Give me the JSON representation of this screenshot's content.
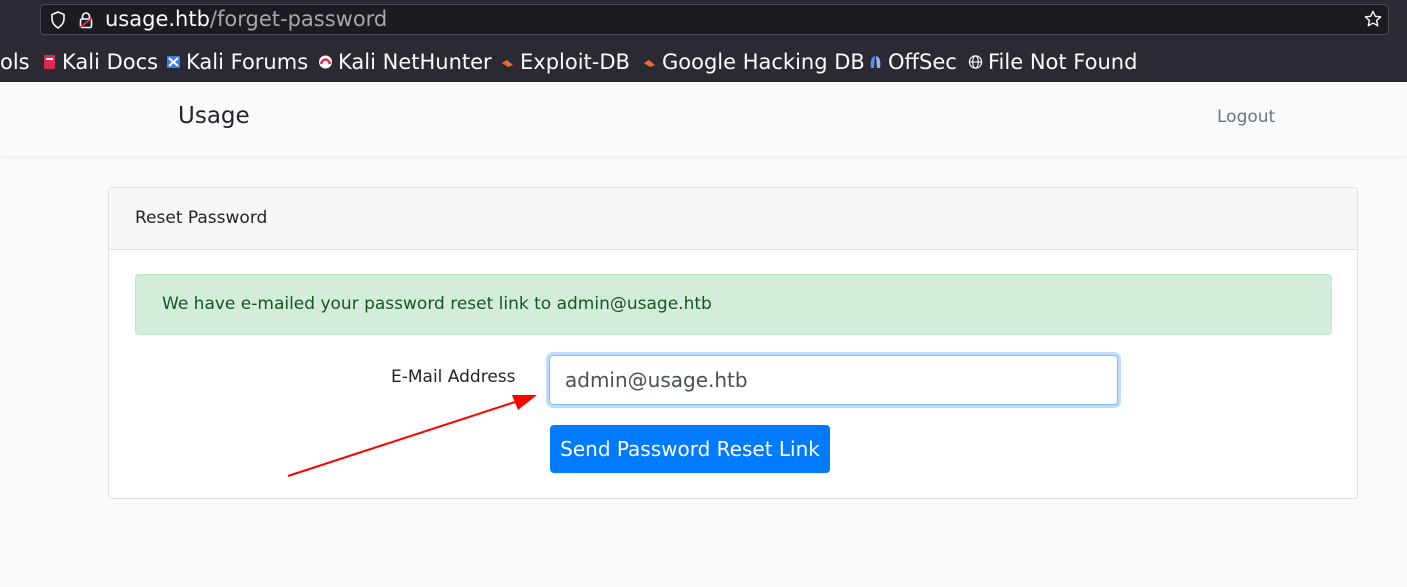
{
  "browser": {
    "url_host": "usage.htb",
    "url_path": "/forget-password",
    "bookmarks": [
      {
        "label": "ols",
        "icon": "none"
      },
      {
        "label": "Kali Docs",
        "icon": "kali-docs-icon"
      },
      {
        "label": "Kali Forums",
        "icon": "kali-forums-icon"
      },
      {
        "label": "Kali NetHunter",
        "icon": "kali-nethunter-icon"
      },
      {
        "label": "Exploit-DB",
        "icon": "exploit-db-icon"
      },
      {
        "label": "Google Hacking DB",
        "icon": "ghdb-icon"
      },
      {
        "label": "OffSec",
        "icon": "offsec-icon"
      },
      {
        "label": "File Not Found",
        "icon": "globe-icon"
      }
    ]
  },
  "navbar": {
    "brand": "Usage",
    "logout": "Logout"
  },
  "card": {
    "header": "Reset Password",
    "alert": "We have e-mailed your password reset link to admin@usage.htb",
    "email_label": "E-Mail Address",
    "email_value": "admin@usage.htb",
    "submit_label": "Send Password Reset Link"
  },
  "colors": {
    "primary": "#007bff",
    "alert_bg": "#d4edda",
    "alert_text": "#155724",
    "annotation_arrow": "#ff0000"
  }
}
